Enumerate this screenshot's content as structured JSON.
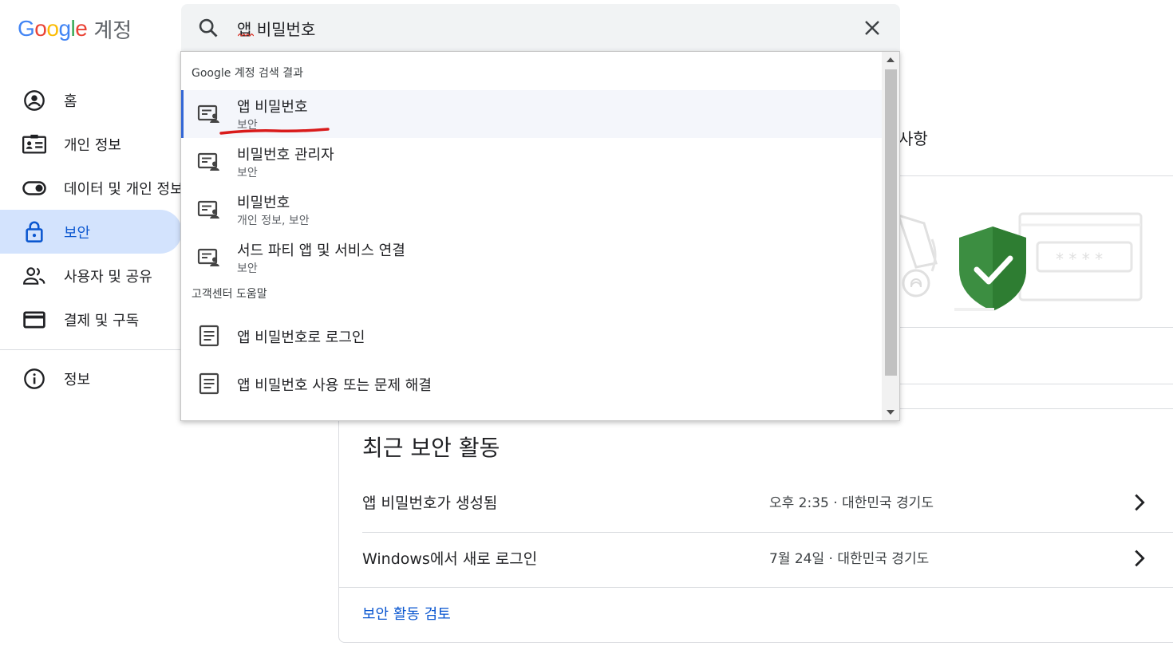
{
  "logo": {
    "letters": [
      "G",
      "o",
      "o",
      "g",
      "l",
      "e"
    ],
    "product": "계정"
  },
  "sidebar": {
    "items": [
      {
        "label": "홈",
        "icon": "account-circle-icon"
      },
      {
        "label": "개인 정보",
        "icon": "badge-icon"
      },
      {
        "label": "데이터 및 개인 정보",
        "icon": "toggle-icon"
      },
      {
        "label": "보안",
        "icon": "lock-icon",
        "active": true
      },
      {
        "label": "사용자 및 공유",
        "icon": "people-icon"
      },
      {
        "label": "결제 및 구독",
        "icon": "credit-card-icon"
      },
      {
        "label": "정보",
        "icon": "info-icon"
      }
    ]
  },
  "search": {
    "value": "앱 비밀번호",
    "placeholder": ""
  },
  "dropdown": {
    "section_account": "Google 계정 검색 결과",
    "account_results": [
      {
        "title": "앱 비밀번호",
        "subtitle": "보안"
      },
      {
        "title": "비밀번호 관리자",
        "subtitle": "보안"
      },
      {
        "title": "비밀번호",
        "subtitle": "개인 정보, 보안"
      },
      {
        "title": "서드 파티 앱 및 서비스 연결",
        "subtitle": "보안"
      }
    ],
    "section_help": "고객센터 도움말",
    "help_results": [
      {
        "title": "앱 비밀번호로 로그인"
      },
      {
        "title": "앱 비밀번호 사용 또는 문제 해결"
      }
    ]
  },
  "background": {
    "partial_text": "사항"
  },
  "recent_activity": {
    "title": "최근 보안 활동",
    "rows": [
      {
        "name": "앱 비밀번호가 생성됨",
        "meta": "오후 2:35 · 대한민국 경기도"
      },
      {
        "name": "Windows에서 새로 로그인",
        "meta": "7월 24일 · 대한민국 경기도"
      }
    ],
    "review_link": "보안 활동 검토"
  },
  "colors": {
    "accent": "#0b57d0",
    "active_bg": "#d3e3fd",
    "shield_green": "#3c8e41",
    "annotation_red": "#d91b1b"
  }
}
